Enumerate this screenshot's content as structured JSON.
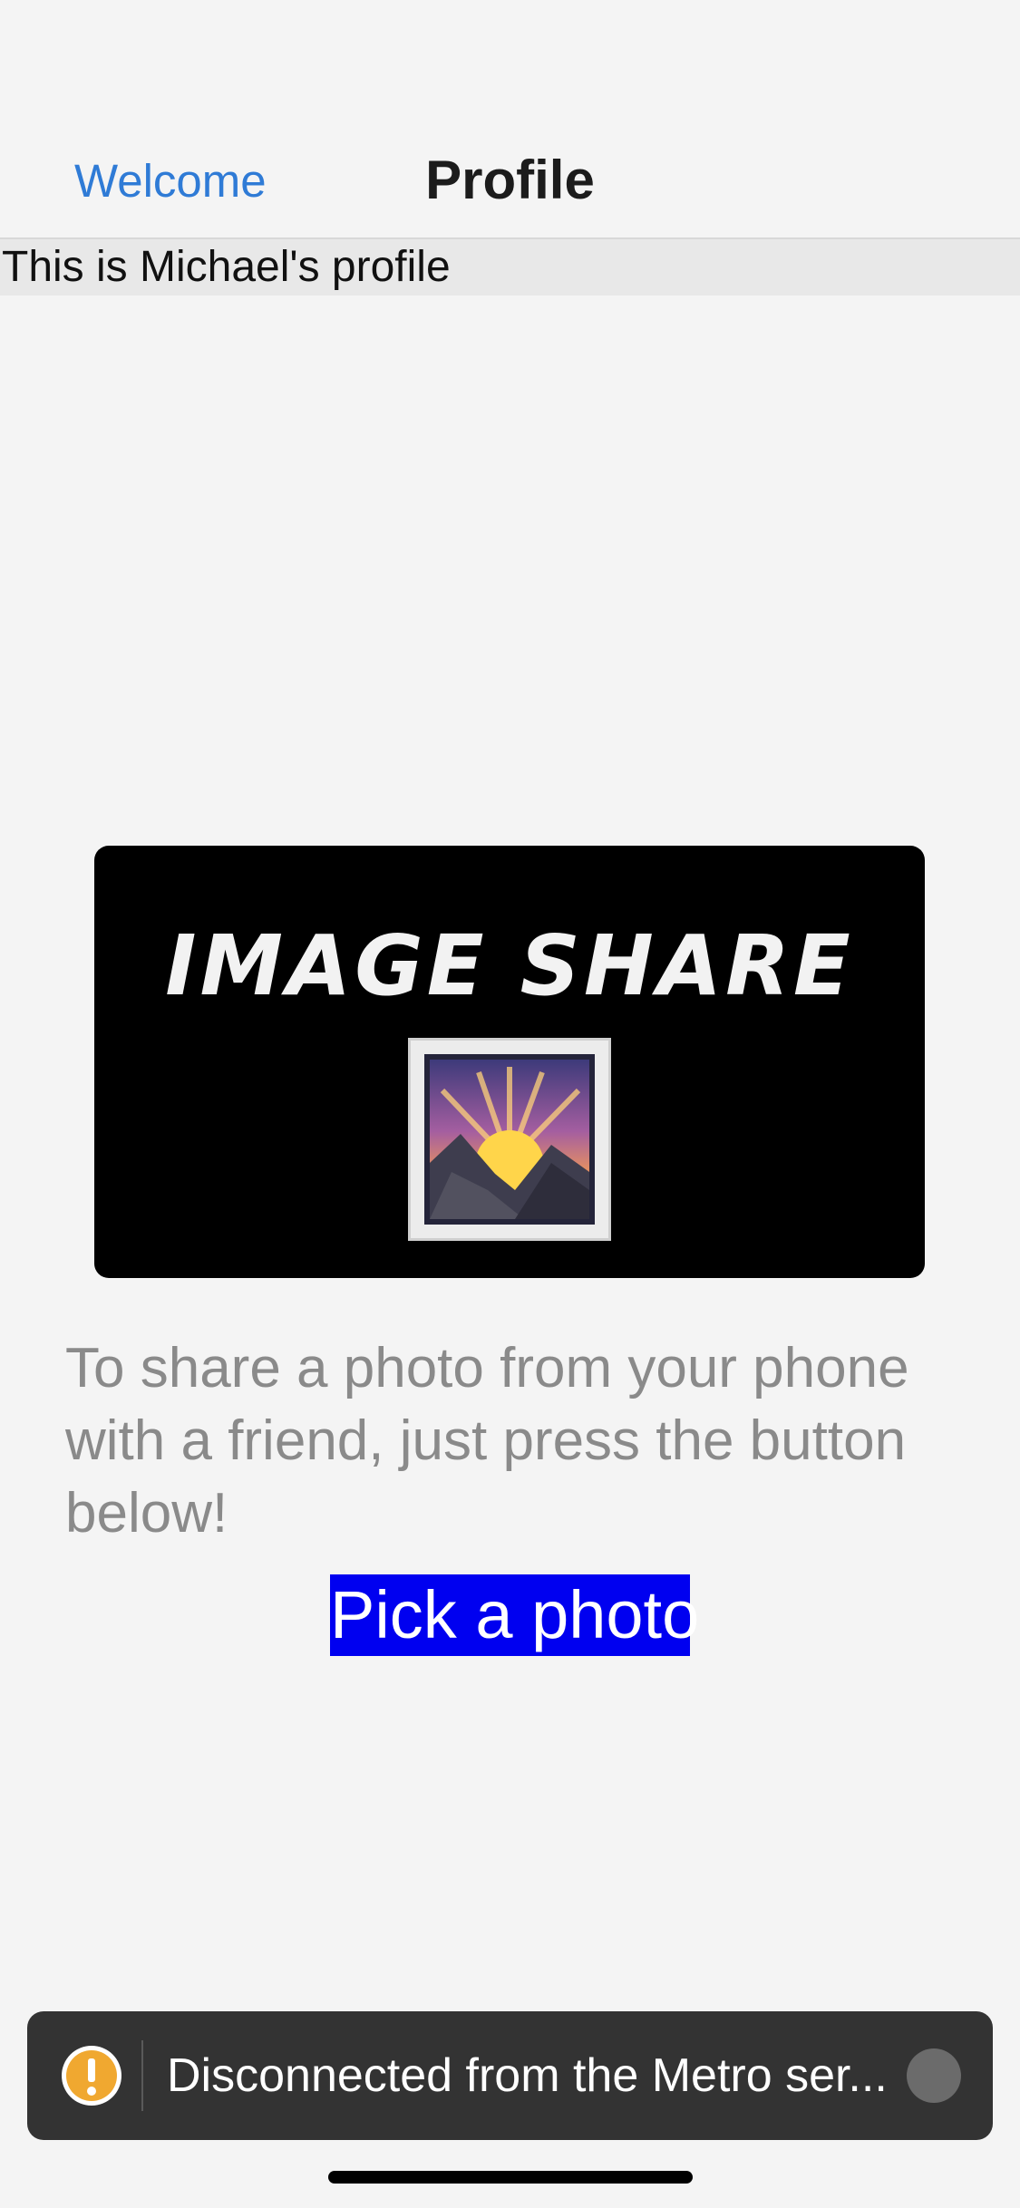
{
  "header": {
    "back_label": "Welcome",
    "title": "Profile"
  },
  "profile_banner": {
    "text": "This is Michael's profile"
  },
  "logo": {
    "text": "IMAGE SHARE",
    "icon": "framed-sunset-picture-icon"
  },
  "instructions": {
    "text": "To share a photo from your phone with a friend, just press the button below!"
  },
  "pick_button": {
    "label": "Pick a photo"
  },
  "toast": {
    "icon": "warning-icon",
    "message": "Disconnected from the Metro ser..."
  },
  "colors": {
    "accent_link": "#2f7bd6",
    "button_background": "#0000f0",
    "toast_background": "#333333",
    "warning": "#f0a830"
  }
}
